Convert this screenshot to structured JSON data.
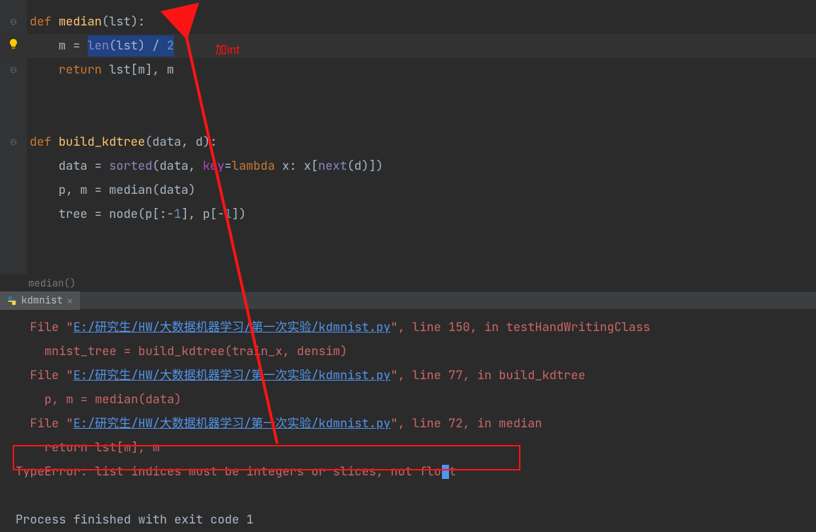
{
  "editor": {
    "lines": [
      {
        "gutter": "fold",
        "segs": [
          {
            "c": "kw",
            "t": "def "
          },
          {
            "c": "fn",
            "t": "median"
          },
          {
            "c": "plain",
            "t": "(lst):"
          }
        ]
      },
      {
        "gutter": "bulb",
        "hl": true,
        "segs": [
          {
            "c": "plain",
            "t": "    m = "
          },
          {
            "sel": true,
            "inner": [
              {
                "c": "bi",
                "t": "len"
              },
              {
                "c": "plain",
                "t": "(lst) / "
              },
              {
                "c": "num",
                "t": "2"
              }
            ]
          }
        ]
      },
      {
        "gutter": "fold",
        "segs": [
          {
            "c": "plain",
            "t": "    "
          },
          {
            "c": "kw",
            "t": "return "
          },
          {
            "c": "plain",
            "t": "lst[m], m"
          }
        ]
      },
      {
        "segs": []
      },
      {
        "segs": []
      },
      {
        "gutter": "fold",
        "segs": [
          {
            "c": "kw",
            "t": "def "
          },
          {
            "c": "fn",
            "t": "build_kdtree"
          },
          {
            "c": "plain",
            "t": "(data, d):"
          }
        ]
      },
      {
        "segs": [
          {
            "c": "plain",
            "t": "    data = "
          },
          {
            "c": "bi",
            "t": "sorted"
          },
          {
            "c": "plain",
            "t": "(data, "
          },
          {
            "c": "pr",
            "t": "key"
          },
          {
            "c": "plain",
            "t": "="
          },
          {
            "c": "kw",
            "t": "lambda "
          },
          {
            "c": "plain",
            "t": "x: x["
          },
          {
            "c": "bi",
            "t": "next"
          },
          {
            "c": "plain",
            "t": "(d)])"
          }
        ]
      },
      {
        "segs": [
          {
            "c": "plain",
            "t": "    p, m = median(data)"
          }
        ]
      },
      {
        "segs": [
          {
            "c": "plain",
            "t": "    tree = node(p[:-"
          },
          {
            "c": "num",
            "t": "1"
          },
          {
            "c": "plain",
            "t": "], p[-"
          },
          {
            "c": "num",
            "t": "1"
          },
          {
            "c": "plain",
            "t": "])"
          }
        ]
      },
      {
        "segs": []
      }
    ],
    "annotation_text": "加int"
  },
  "crumb": "median()",
  "tab": {
    "label": "kdmnist"
  },
  "console": {
    "trace": [
      {
        "prefix": "  File \"",
        "link": "E:/研究生/HW/大数据机器学习/第一次实验/kdmnist.py",
        "suffix": "\", line 150, in testHandWritingClass"
      },
      {
        "code": "    mnist_tree = build_kdtree(train_x, densim)"
      },
      {
        "prefix": "  File \"",
        "link": "E:/研究生/HW/大数据机器学习/第一次实验/kdmnist.py",
        "suffix": "\", line 77, in build_kdtree"
      },
      {
        "code": "    p, m = median(data)"
      },
      {
        "prefix": "  File \"",
        "link": "E:/研究生/HW/大数据机器学习/第一次实验/kdmnist.py",
        "suffix": "\", line 72, in median"
      },
      {
        "code": "    return lst[m], m"
      }
    ],
    "error": "TypeError: list indices must be integers or slices, not float",
    "process": "Process finished with exit code 1"
  }
}
